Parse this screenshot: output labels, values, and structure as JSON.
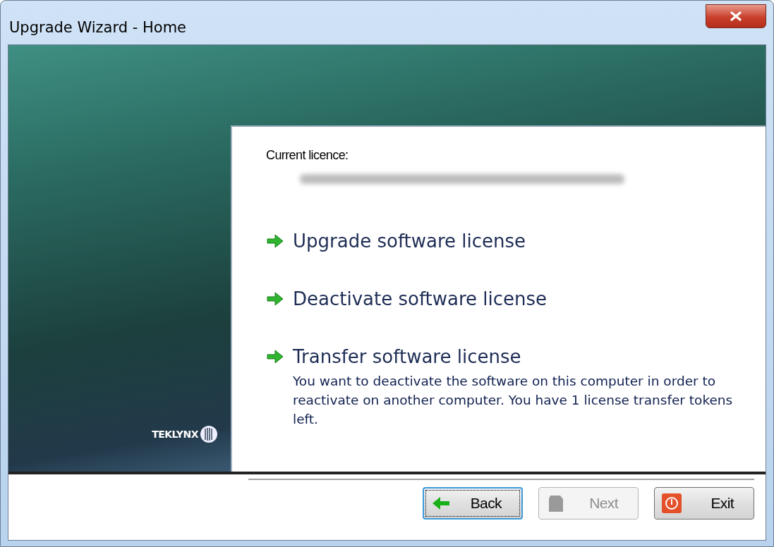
{
  "window": {
    "title": "Upgrade Wizard - Home"
  },
  "logo": {
    "text": "TEKLYNX"
  },
  "current_licence": {
    "label": "Current licence:"
  },
  "actions": [
    {
      "label": "Upgrade software license"
    },
    {
      "label": "Deactivate software license"
    },
    {
      "label": "Transfer software license",
      "description": "You want to deactivate the software on this computer in order to reactivate on another computer. You have 1 license transfer tokens left."
    }
  ],
  "buttons": [
    {
      "label": "Back",
      "kind": "back",
      "focused": true,
      "disabled": false
    },
    {
      "label": "Next",
      "kind": "next",
      "focused": false,
      "disabled": true
    },
    {
      "label": "Exit",
      "kind": "exit",
      "focused": false,
      "disabled": false
    }
  ]
}
